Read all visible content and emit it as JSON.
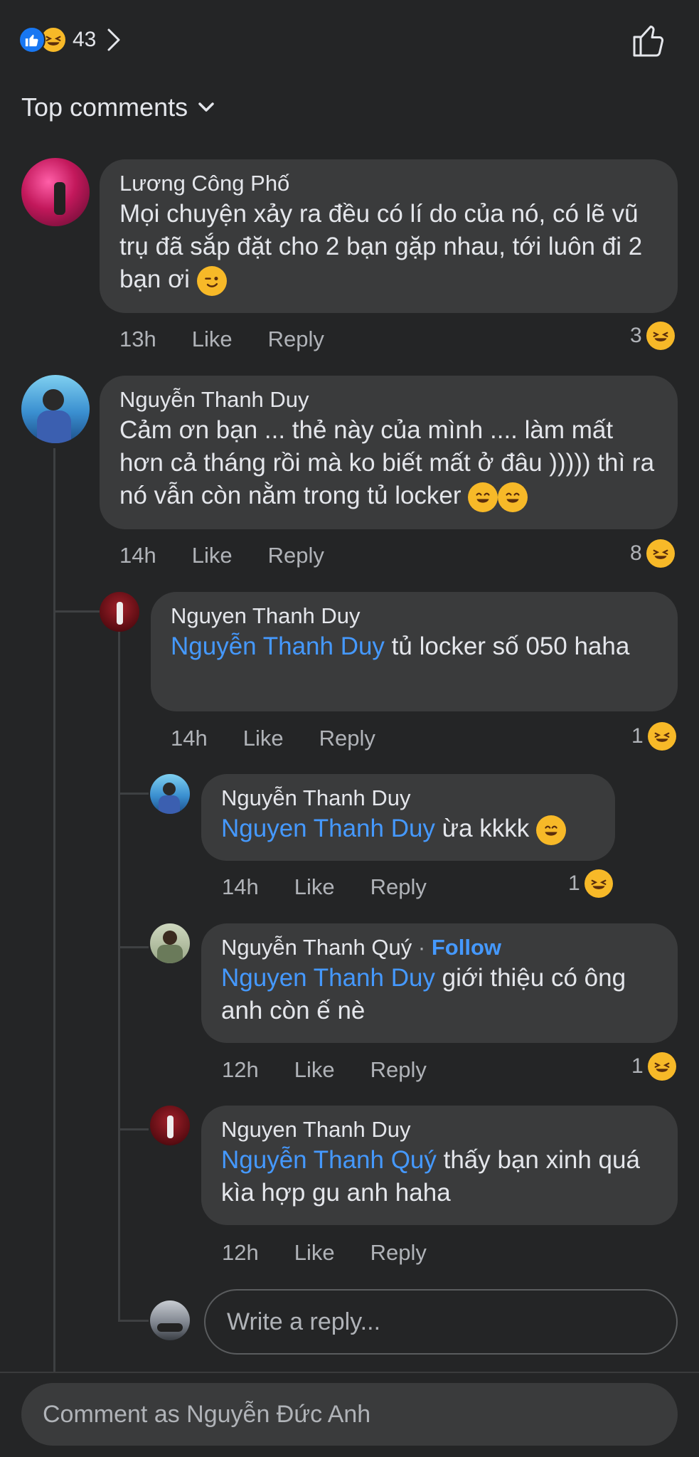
{
  "reactions": {
    "count": "43"
  },
  "sort": {
    "label": "Top comments"
  },
  "comments": [
    {
      "author": "Lương Công Phố",
      "text": "Mọi chuyện xảy ra đều có lí do của nó, có lẽ vũ trụ đã sắp đặt cho 2 bạn gặp nhau, tới luôn đi 2 bạn ơi",
      "time": "13h",
      "like": "Like",
      "reply": "Reply",
      "reaction_count": "3"
    },
    {
      "author": "Nguyễn Thanh Duy",
      "text": "Cảm ơn bạn ... thẻ này của mình .... làm mất hơn cả tháng rồi mà ko biết mất ở đâu )))))  thì ra nó vẫn còn nằm trong tủ locker",
      "time": "14h",
      "like": "Like",
      "reply": "Reply",
      "reaction_count": "8"
    }
  ],
  "replies": [
    {
      "author": "Nguyen Thanh Duy",
      "mention": "Nguyễn Thanh Duy",
      "text": " tủ locker số 050 haha",
      "time": "14h",
      "like": "Like",
      "reply": "Reply",
      "reaction_count": "1"
    },
    {
      "author": "Nguyễn Thanh Duy",
      "mention": "Nguyen Thanh Duy",
      "text": " ừa kkkk",
      "time": "14h",
      "like": "Like",
      "reply": "Reply",
      "reaction_count": "1"
    },
    {
      "author": "Nguyễn Thanh Quý",
      "follow": "Follow",
      "mention": "Nguyen Thanh Duy",
      "text": " giới thiệu có ông anh còn ế nè",
      "time": "12h",
      "like": "Like",
      "reply": "Reply",
      "reaction_count": "1"
    },
    {
      "author": "Nguyen Thanh Duy",
      "mention": "Nguyễn Thanh Quý",
      "text": " thấy bạn xinh quá kìa hợp gu anh haha",
      "time": "12h",
      "like": "Like",
      "reply": "Reply"
    }
  ],
  "reply_input": {
    "placeholder": "Write a reply..."
  },
  "comment_input": {
    "placeholder": "Comment as Nguyễn Đức Anh"
  },
  "colors": {
    "background": "#242526",
    "bubble": "#3a3b3c",
    "mention": "#4599ff",
    "like_blue": "#1877f2",
    "haha_yellow": "#f7b928"
  }
}
